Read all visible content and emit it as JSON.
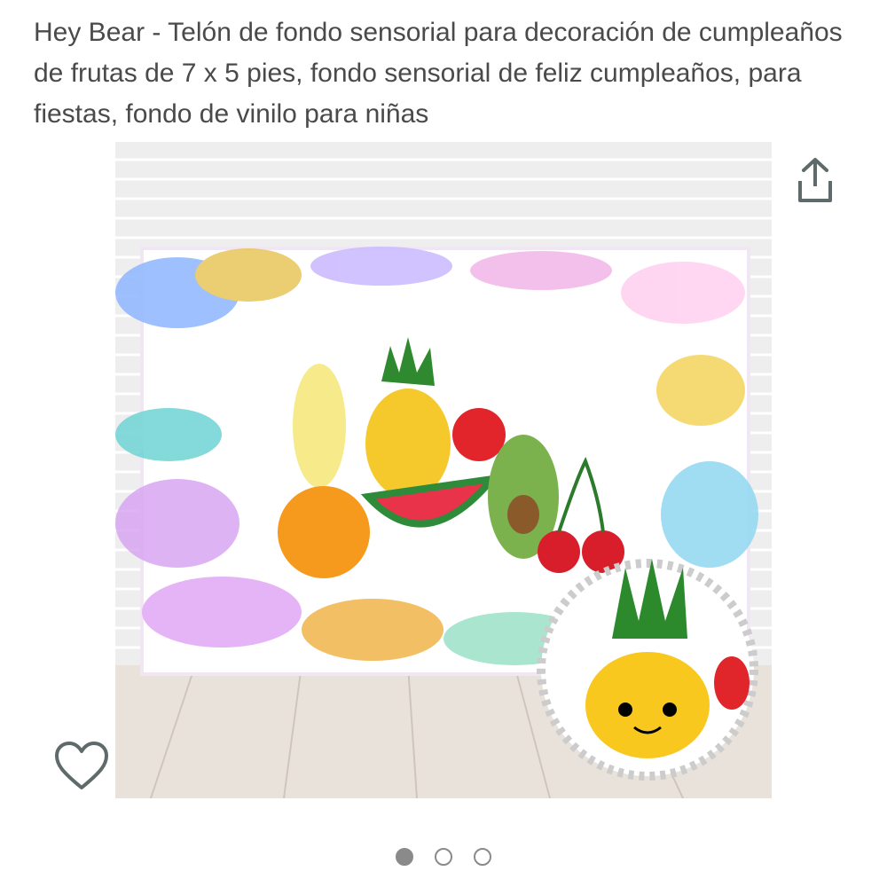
{
  "product": {
    "title": "Hey Bear - Telón de fondo sensorial para decoración de cumpleaños de frutas de 7 x 5 pies, fondo sensorial de feliz cumpleaños, para fiestas, fondo de vinilo para niñas"
  },
  "image": {
    "description_icon": "product-photo",
    "current_index": 1,
    "total": 3
  },
  "icons": {
    "share": "share-icon",
    "wishlist": "heart-outline-icon"
  },
  "colors": {
    "text": "#4a4a4a",
    "icon": "#5f6b6b",
    "dot_active": "#8a8a8a"
  }
}
